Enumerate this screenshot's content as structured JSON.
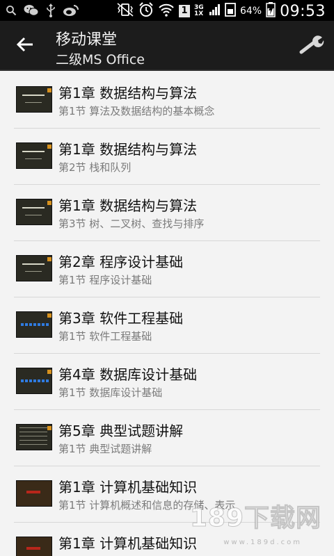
{
  "status_bar": {
    "network": "3G 1X",
    "sim_badge": "1",
    "battery_percent": "64%",
    "time": "09:53",
    "icons": [
      "search-icon",
      "wechat-icon",
      "usb-icon",
      "weibo-icon",
      "vibrate-icon",
      "alarm-icon",
      "wifi-icon",
      "signal-icon",
      "battery-icon"
    ]
  },
  "action_bar": {
    "title": "移动课堂",
    "subtitle": "二级MS Office"
  },
  "lessons": [
    {
      "title": "第1章 数据结构与算法",
      "subtitle": "第1节 算法及数据结构的基本概念"
    },
    {
      "title": "第1章 数据结构与算法",
      "subtitle": "第2节 栈和队列"
    },
    {
      "title": "第1章 数据结构与算法",
      "subtitle": "第3节 树、二叉树、查找与排序"
    },
    {
      "title": "第2章 程序设计基础",
      "subtitle": "第1节 程序设计基础"
    },
    {
      "title": "第3章 软件工程基础",
      "subtitle": "第1节 软件工程基础"
    },
    {
      "title": "第4章 数据库设计基础",
      "subtitle": "第1节 数据库设计基础"
    },
    {
      "title": "第5章 典型试题讲解",
      "subtitle": "第1节 典型试题讲解"
    },
    {
      "title": "第1章 计算机基础知识",
      "subtitle": "第1节 计算机概述和信息的存储、表示"
    },
    {
      "title": "第1章 计算机基础知识",
      "subtitle": ""
    }
  ],
  "watermark": {
    "text": "189下载网",
    "url": "www.189d.com"
  },
  "colors": {
    "action_bar_bg": "#1c1c1c",
    "list_bg": "#f3f3f3",
    "divider": "#d7d7d7"
  }
}
